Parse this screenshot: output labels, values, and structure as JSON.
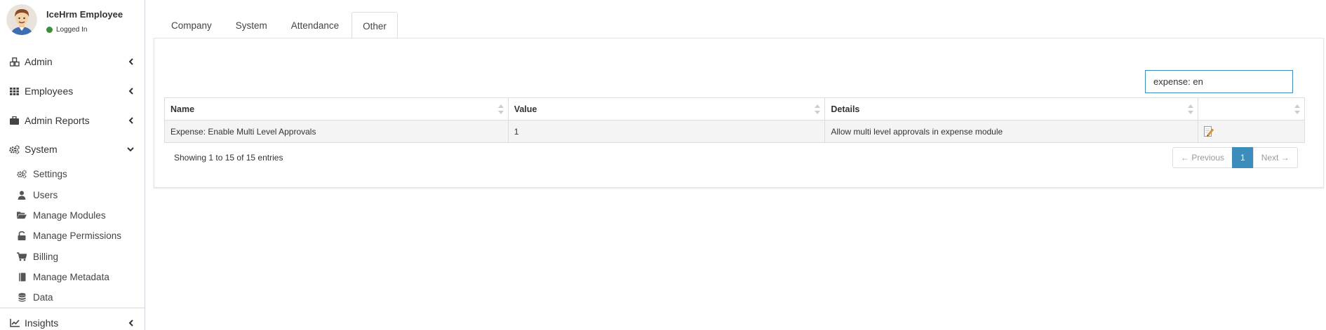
{
  "user": {
    "name": "IceHrm Employee",
    "status": "Logged In"
  },
  "sidebar": {
    "menu": [
      {
        "label": "Admin",
        "icon": "cubes-icon",
        "expanded": false
      },
      {
        "label": "Employees",
        "icon": "grid-icon",
        "expanded": false
      },
      {
        "label": "Admin Reports",
        "icon": "briefcase-icon",
        "expanded": false
      },
      {
        "label": "System",
        "icon": "cogs-icon",
        "expanded": true
      },
      {
        "label": "Insights",
        "icon": "line-chart-icon",
        "expanded": false
      }
    ],
    "system_items": [
      {
        "label": "Settings",
        "icon": "cogs-icon"
      },
      {
        "label": "Users",
        "icon": "user-icon"
      },
      {
        "label": "Manage Modules",
        "icon": "folder-open-icon"
      },
      {
        "label": "Manage Permissions",
        "icon": "unlock-icon"
      },
      {
        "label": "Billing",
        "icon": "shopping-cart-icon"
      },
      {
        "label": "Manage Metadata",
        "icon": "book-icon"
      },
      {
        "label": "Data",
        "icon": "database-icon"
      }
    ]
  },
  "tabs": [
    {
      "label": "Company",
      "active": false
    },
    {
      "label": "System",
      "active": false
    },
    {
      "label": "Attendance",
      "active": false
    },
    {
      "label": "Other",
      "active": true
    }
  ],
  "search": {
    "value": "expense: en"
  },
  "table": {
    "columns": [
      "Name",
      "Value",
      "Details",
      ""
    ],
    "rows": [
      {
        "name": "Expense: Enable Multi Level Approvals",
        "value": "1",
        "details": "Allow multi level approvals in expense module"
      }
    ]
  },
  "info": "Showing 1 to 15 of 15 entries",
  "pagination": {
    "previous": "← Previous",
    "current": "1",
    "next": "Next →"
  },
  "colors": {
    "accent": "#3c8dbc",
    "status_online": "#3c8d3c",
    "row_background": "#f4f4f4"
  }
}
